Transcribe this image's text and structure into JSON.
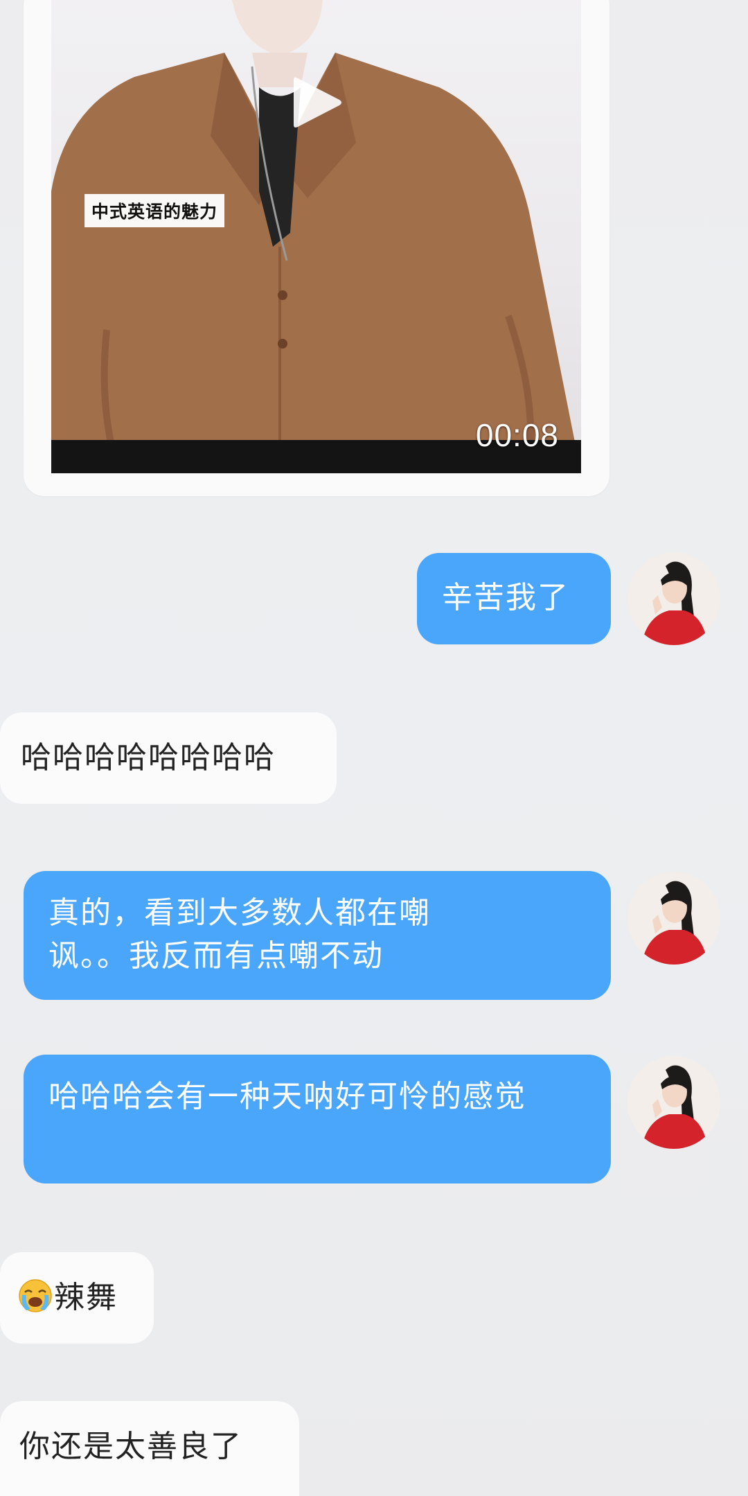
{
  "video_message": {
    "caption": "中式英语的魅力",
    "duration": "00:08"
  },
  "messages": [
    {
      "sender": "me",
      "text": "辛苦我了"
    },
    {
      "sender": "other",
      "text": "哈哈哈哈哈哈哈哈"
    },
    {
      "sender": "me",
      "text": "真的，看到大多数人都在嘲讽。。我反而有点嘲不动"
    },
    {
      "sender": "me",
      "text": "哈哈哈会有一种天呐好可怜的感觉"
    },
    {
      "sender": "other",
      "emoji": "loudly-crying-face",
      "text": "辣舞"
    },
    {
      "sender": "other",
      "text": "你还是太善良了"
    }
  ],
  "colors": {
    "outgoing_bubble": "#4aa6fb",
    "incoming_bubble": "#fbfbfc",
    "background": "#ededef"
  }
}
